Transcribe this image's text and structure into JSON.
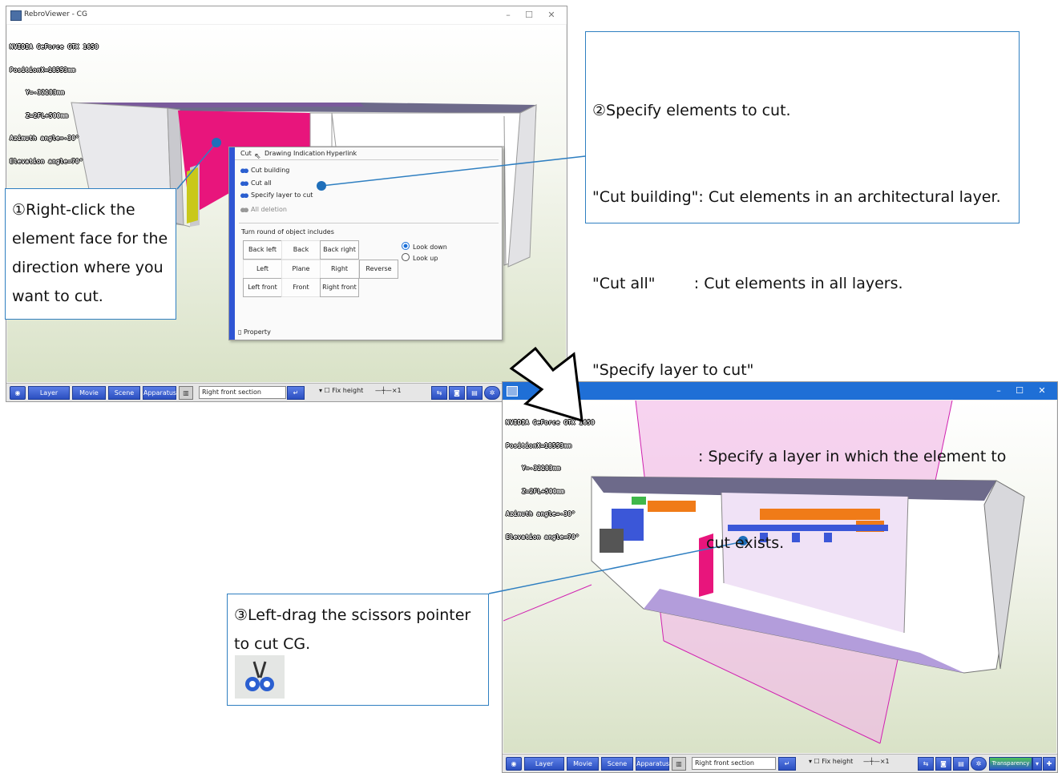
{
  "window1": {
    "title": "RebroViewer - CG",
    "info": [
      "NVIDIA GeForce GTX 1650",
      "PositionX=18553mm",
      "Y=-32183mm",
      "Z=2FL+500mm",
      "Azimuth angle=-30°",
      "Elevation angle=70°"
    ],
    "controls": {
      "minimize": "–",
      "maximize": "☐",
      "close": "✕"
    }
  },
  "context_menu": {
    "tabs": [
      "Cut",
      "Drawing",
      "Indication",
      "Hyperlink"
    ],
    "items": [
      "Cut building",
      "Cut all",
      "Specify layer to cut",
      "All deletion"
    ],
    "section_label": "Turn round of object includes",
    "direction_buttons": [
      "Back left",
      "Back",
      "Back right",
      "Left",
      "Plane",
      "Right",
      "Reverse",
      "Left front",
      "Front",
      "Right front"
    ],
    "radios": [
      "Look down",
      "Look up"
    ],
    "selected_radio": "Look down",
    "property_label": "Property"
  },
  "toolbar": {
    "layer": "Layer",
    "movie": "Movie",
    "scene": "Scene",
    "apparatus": "Apparatus",
    "view_select": "Right front section",
    "fix_height": "Fix height",
    "scale": "×1",
    "transparency": "Transparency"
  },
  "callout1": {
    "lines": [
      "①Right-click the",
      "element face for the",
      "direction where you",
      "want to cut."
    ]
  },
  "callout2": {
    "lines": [
      "②Specify elements to cut.",
      "\"Cut building\": Cut elements in an architectural layer.",
      "\"Cut all\"        : Cut elements in all layers.",
      "\"Specify layer to cut\"",
      ": Specify a layer in which the element to",
      "cut exists."
    ]
  },
  "callout3": {
    "lines": [
      "③Left-drag the scissors pointer",
      "to cut CG."
    ],
    "icon": "scissors-pointer-icon"
  },
  "colors": {
    "accent": "#2f7fc1",
    "pin": "#1f6fba",
    "magenta": "#e8157c",
    "win2_title": "#1f6fd6"
  }
}
